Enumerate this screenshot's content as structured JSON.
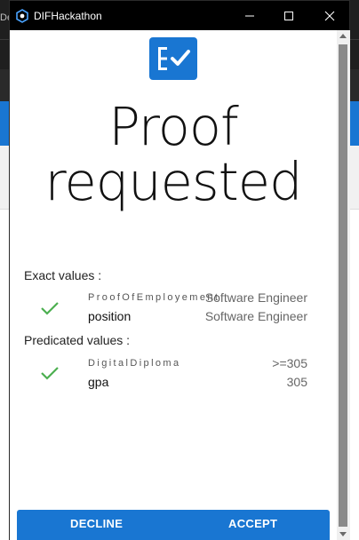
{
  "window": {
    "title": "DIFHackathon",
    "background_tab_text": "De",
    "icons": [
      "app-icon",
      "minimize-icon",
      "maximize-icon",
      "close-icon"
    ]
  },
  "page": {
    "logo_icon": "checklist-icon",
    "heading_line1": "Proof",
    "heading_line2": "requested"
  },
  "exact": {
    "label": "Exact values :",
    "credential": "ProofOfEmployement",
    "credential_value": "Software Engineer",
    "attribute": "position",
    "attribute_value": "Software Engineer"
  },
  "predicated": {
    "label": "Predicated values :",
    "credential": "DigitalDiploma",
    "credential_value": ">=305",
    "attribute": "gpa",
    "attribute_value": "305"
  },
  "actions": {
    "decline": "DECLINE",
    "accept": "ACCEPT"
  },
  "colors": {
    "primary": "#1976d2",
    "check": "#4caf50",
    "titlebar": "#000000"
  }
}
